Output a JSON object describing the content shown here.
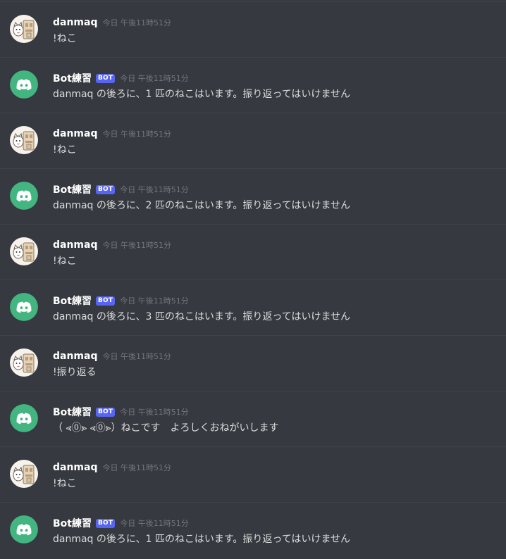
{
  "colors": {
    "background": "#36393f",
    "divider": "#3f4248",
    "username": "#ffffff",
    "text": "#dcddde",
    "timestamp": "#72767d",
    "bot_tag": "#5865f2",
    "bot_avatar": "#43b581"
  },
  "messages": [
    {
      "author": "danmaq",
      "is_bot": false,
      "avatar_icon": "cat-sketch-avatar-icon",
      "timestamp": "今日 午後11時51分",
      "content": "!ねこ"
    },
    {
      "author": "Bot練習",
      "is_bot": true,
      "bot_tag": "BOT",
      "avatar_icon": "discord-logo-icon",
      "timestamp": "今日 午後11時51分",
      "content": "danmaq の後ろに、1 匹のねこはいます。振り返ってはいけません"
    },
    {
      "author": "danmaq",
      "is_bot": false,
      "avatar_icon": "cat-sketch-avatar-icon",
      "timestamp": "今日 午後11時51分",
      "content": "!ねこ"
    },
    {
      "author": "Bot練習",
      "is_bot": true,
      "bot_tag": "BOT",
      "avatar_icon": "discord-logo-icon",
      "timestamp": "今日 午後11時51分",
      "content": "danmaq の後ろに、2 匹のねこはいます。振り返ってはいけません"
    },
    {
      "author": "danmaq",
      "is_bot": false,
      "avatar_icon": "cat-sketch-avatar-icon",
      "timestamp": "今日 午後11時51分",
      "content": "!ねこ"
    },
    {
      "author": "Bot練習",
      "is_bot": true,
      "bot_tag": "BOT",
      "avatar_icon": "discord-logo-icon",
      "timestamp": "今日 午後11時51分",
      "content": "danmaq の後ろに、3 匹のねこはいます。振り返ってはいけません"
    },
    {
      "author": "danmaq",
      "is_bot": false,
      "avatar_icon": "cat-sketch-avatar-icon",
      "timestamp": "今日 午後11時51分",
      "content": "!振り返る"
    },
    {
      "author": "Bot練習",
      "is_bot": true,
      "bot_tag": "BOT",
      "avatar_icon": "discord-logo-icon",
      "timestamp": "今日 午後11時51分",
      "content": "（ ⪡⓪⪢ ⪡⓪⪢）ねこです　よろしくおねがいします"
    },
    {
      "author": "danmaq",
      "is_bot": false,
      "avatar_icon": "cat-sketch-avatar-icon",
      "timestamp": "今日 午後11時51分",
      "content": "!ねこ"
    },
    {
      "author": "Bot練習",
      "is_bot": true,
      "bot_tag": "BOT",
      "avatar_icon": "discord-logo-icon",
      "timestamp": "今日 午後11時51分",
      "content": "danmaq の後ろに、1 匹のねこはいます。振り返ってはいけません"
    }
  ]
}
